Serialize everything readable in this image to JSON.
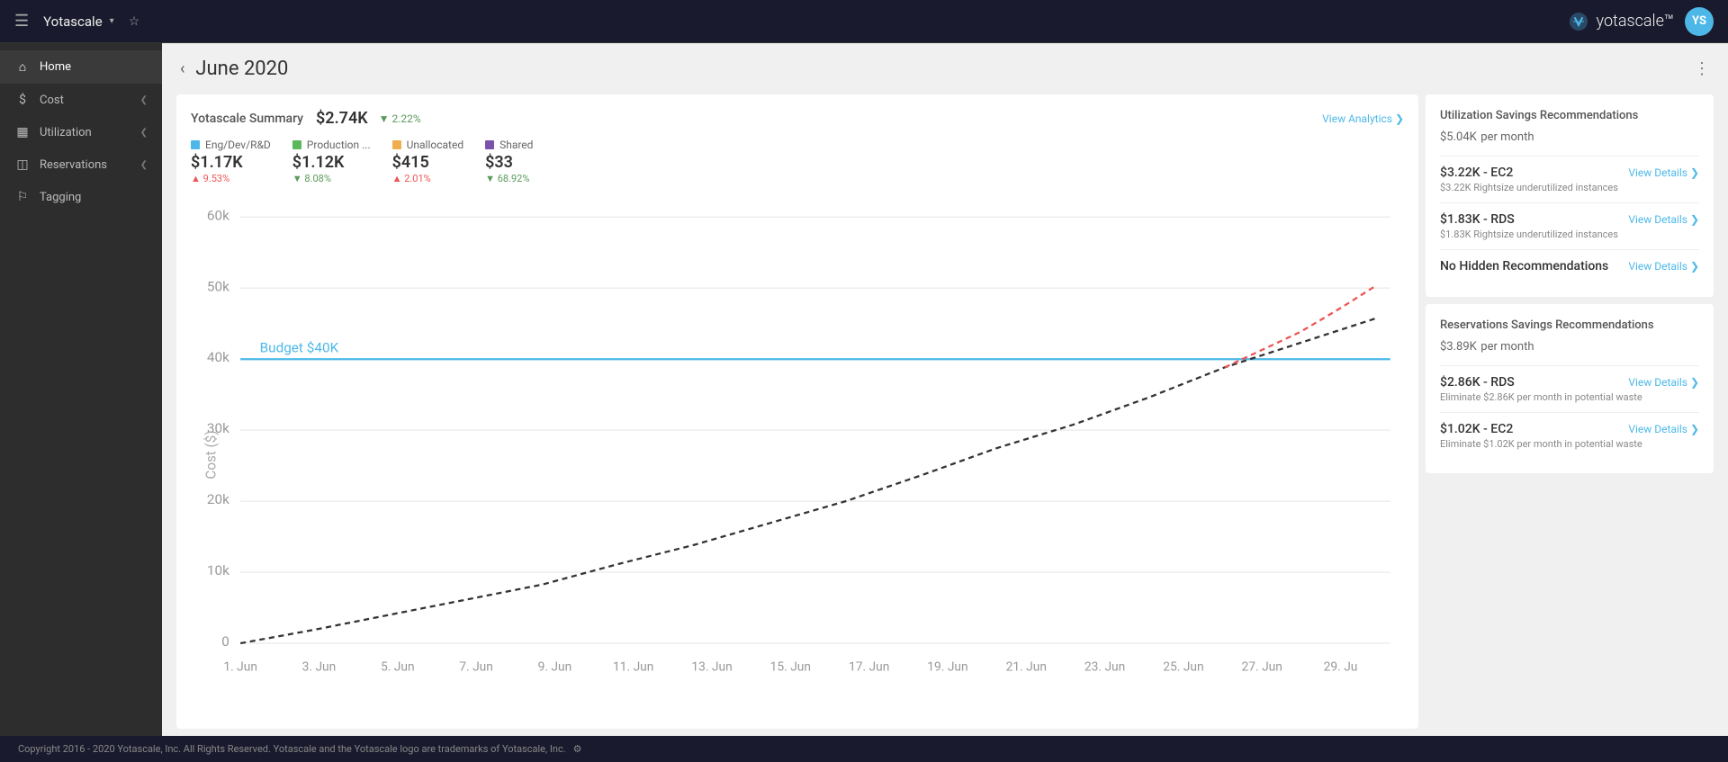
{
  "topnav": {
    "brand": "Yotascale",
    "brand_arrow": "▾",
    "logo_text": "yotascale™",
    "avatar_initials": "YS"
  },
  "sidebar": {
    "items": [
      {
        "id": "home",
        "label": "Home",
        "icon": "⌂",
        "active": true,
        "arrow": false
      },
      {
        "id": "cost",
        "label": "Cost",
        "icon": "💲",
        "active": false,
        "arrow": true
      },
      {
        "id": "utilization",
        "label": "Utilization",
        "icon": "📊",
        "active": false,
        "arrow": true
      },
      {
        "id": "reservations",
        "label": "Reservations",
        "icon": "📋",
        "active": false,
        "arrow": true
      },
      {
        "id": "tagging",
        "label": "Tagging",
        "icon": "🏷",
        "active": false,
        "arrow": false
      }
    ]
  },
  "page": {
    "title": "June 2020",
    "summary_label": "Yotascale Summary",
    "summary_amount": "$2.74K",
    "summary_change": "▼ 2.22%",
    "view_analytics": "View Analytics ❯"
  },
  "legend": [
    {
      "id": "eng",
      "label": "Eng/Dev/R&D",
      "color": "#4db8e8",
      "amount": "$1.17K",
      "pct": "▲ 9.53%",
      "dir": "up"
    },
    {
      "id": "prod",
      "label": "Production ...",
      "color": "#5cb85c",
      "amount": "$1.12K",
      "pct": "▼ 8.08%",
      "dir": "down"
    },
    {
      "id": "unalloc",
      "label": "Unallocated",
      "color": "#f0ad4e",
      "amount": "$415",
      "pct": "▲ 2.01%",
      "dir": "up"
    },
    {
      "id": "shared",
      "label": "Shared",
      "color": "#7b52ab",
      "amount": "$33",
      "pct": "▼ 68.92%",
      "dir": "down"
    }
  ],
  "chart": {
    "y_labels": [
      "60k",
      "50k",
      "40k",
      "30k",
      "20k",
      "10k",
      "0"
    ],
    "x_labels": [
      "1. Jun",
      "3. Jun",
      "5. Jun",
      "7. Jun",
      "9. Jun",
      "11. Jun",
      "13. Jun",
      "15. Jun",
      "17. Jun",
      "19. Jun",
      "21. Jun",
      "23. Jun",
      "25. Jun",
      "27. Jun",
      "29. Ju"
    ],
    "budget_label": "Budget $40K",
    "y_axis_label": "Cost ($)"
  },
  "utilization_panel": {
    "title": "Utilization Savings Recommendations",
    "amount": "$5.04K",
    "amount_suffix": "per month",
    "items": [
      {
        "name": "$3.22K - EC2",
        "desc": "$3.22K Rightsize underutilized instances",
        "link": "View Details ❯"
      },
      {
        "name": "$1.83K - RDS",
        "desc": "$1.83K Rightsize underutilized instances",
        "link": "View Details ❯"
      },
      {
        "name": "No Hidden Recommendations",
        "desc": "",
        "link": "View Details ❯"
      }
    ]
  },
  "reservations_panel": {
    "title": "Reservations Savings Recommendations",
    "amount": "$3.89K",
    "amount_suffix": "per month",
    "items": [
      {
        "name": "$2.86K - RDS",
        "desc": "Eliminate $2.86K per month in potential waste",
        "link": "View Details ❯"
      },
      {
        "name": "$1.02K - EC2",
        "desc": "Eliminate $1.02K per month in potential waste",
        "link": "View Details ❯"
      }
    ]
  },
  "footer": {
    "text": "Copyright 2016 - 2020 Yotascale, Inc. All Rights Reserved. Yotascale and the Yotascale logo are trademarks of Yotascale, Inc."
  }
}
